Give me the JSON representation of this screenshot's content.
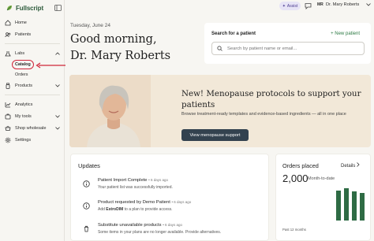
{
  "brand": {
    "name": "Fullscript",
    "color": "#2c5a3a"
  },
  "sidebar": {
    "items": [
      {
        "label": "Home",
        "icon": "home-icon"
      },
      {
        "label": "Patients",
        "icon": "patients-icon"
      },
      {
        "label": "Labs",
        "icon": "labs-icon",
        "expanded": true,
        "children": [
          {
            "label": "Catalog",
            "highlighted": true
          },
          {
            "label": "Orders"
          }
        ]
      },
      {
        "label": "Products",
        "icon": "products-icon"
      },
      {
        "label": "Analytics",
        "icon": "analytics-icon"
      },
      {
        "label": "My tools",
        "icon": "tools-icon"
      },
      {
        "label": "Shop wholesale",
        "icon": "wholesale-icon"
      },
      {
        "label": "Settings",
        "icon": "gear-icon"
      }
    ]
  },
  "topbar": {
    "assist_label": "Assist",
    "initials": "MR",
    "user_name": "Dr. Mary Roberts"
  },
  "greeting": {
    "date": "Tuesday, June 24",
    "line1": "Good morning,",
    "line2": "Dr. Mary Roberts"
  },
  "search": {
    "title": "Search for a patient",
    "new_patient": "+ New patient",
    "placeholder": "Search by patient name or email..."
  },
  "banner": {
    "title": "New! Menopause protocols to support your patients",
    "description": "Browse treatment-ready templates and evidence-based ingredients — all in one place",
    "button": "View menopause support"
  },
  "updates": {
    "title": "Updates",
    "items": [
      {
        "title": "Patient Import Complete",
        "ago": "• 6 days ago",
        "sub_pre": "Your patient list was successfully imported.",
        "sub_bold": "",
        "sub_post": "",
        "icon": "info-icon"
      },
      {
        "title": "Product requested by Demo Patient",
        "ago": "• 6 days ago",
        "sub_pre": "Add ",
        "sub_bold": "EstroDIM",
        "sub_post": " to a plan to provide access.",
        "icon": "info-icon"
      },
      {
        "title": "Substitute unavailable products",
        "ago": "• 6 days ago",
        "sub_pre": "Some items in your plans are no longer available. Provide alternatives.",
        "sub_bold": "",
        "sub_post": "",
        "icon": "trash-icon"
      }
    ]
  },
  "orders": {
    "title": "Orders placed",
    "details": "Details",
    "count": "2,000",
    "count_label": "Month-to-date",
    "footer": "Past 12 months",
    "bar_color": "#2e6b44",
    "bar_levels": [
      0.88,
      0.95,
      0.85,
      0.82
    ]
  },
  "colors": {
    "highlight_outline": "#d0263a",
    "banner_bg": "#f2e8d8",
    "button_bg": "#33424f",
    "link_green": "#2c7a43"
  }
}
